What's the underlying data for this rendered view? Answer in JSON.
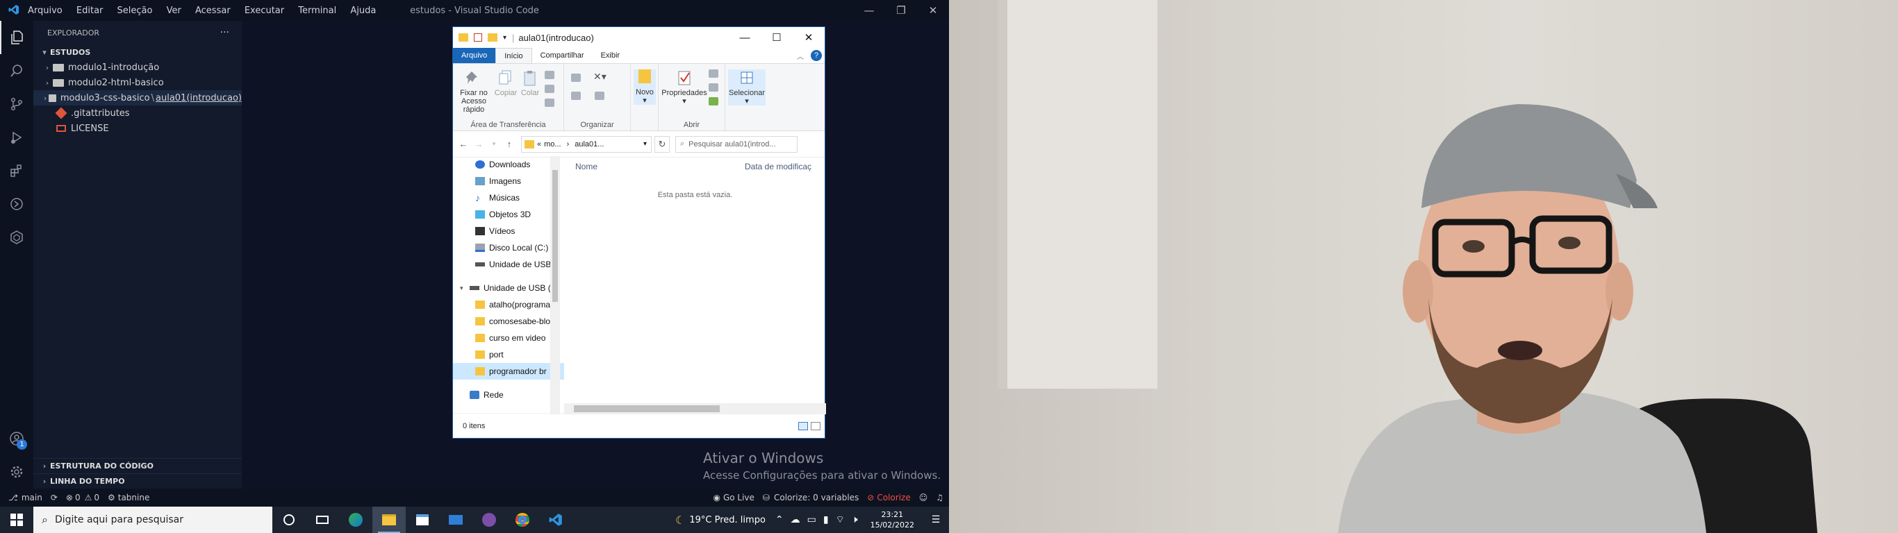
{
  "vscode": {
    "menu": [
      "Arquivo",
      "Editar",
      "Seleção",
      "Ver",
      "Acessar",
      "Executar",
      "Terminal",
      "Ajuda"
    ],
    "window_title": "estudos - Visual Studio Code",
    "sidebar": {
      "title": "EXPLORADOR",
      "more": "···",
      "workspace": "ESTUDOS",
      "items": [
        {
          "label": "modulo1-introdução"
        },
        {
          "label": "modulo2-html-basico"
        },
        {
          "label": "modulo3-css-basico",
          "suffix": "aula01(introducao)"
        },
        {
          "label": ".gitattributes"
        },
        {
          "label": "LICENSE"
        }
      ],
      "bottom_sections": [
        "ESTRUTURA DO CÓDIGO",
        "LINHA DO TEMPO"
      ]
    },
    "account_badge": "1",
    "statusbar": {
      "branch": "main",
      "problems_errors": "0",
      "problems_warnings": "0",
      "tabnine": "tabnine",
      "golive": "Go Live",
      "colorize_vars": "Colorize: 0 variables",
      "colorize": "Colorize",
      "accent": "#f05040"
    }
  },
  "file_explorer": {
    "title": "aula01(introducao)",
    "tabs": [
      "Arquivo",
      "Início",
      "Compartilhar",
      "Exibir"
    ],
    "active_tab": "Início",
    "ribbon": {
      "clipboard": {
        "pin": "Fixar no Acesso rápido",
        "copy": "Copiar",
        "paste": "Colar",
        "group": "Área de Transferência"
      },
      "organize": {
        "group": "Organizar"
      },
      "new": {
        "label": "Novo"
      },
      "open": {
        "properties": "Propriedades",
        "group": "Abrir"
      },
      "select": {
        "label": "Selecionar"
      }
    },
    "address": {
      "part1": "mo...",
      "part2": "aula01..."
    },
    "search_placeholder": "Pesquisar aula01(introd...",
    "nav_items": [
      {
        "label": "Downloads",
        "icon": "download-icon"
      },
      {
        "label": "Imagens",
        "icon": "images-icon"
      },
      {
        "label": "Músicas",
        "icon": "music-icon"
      },
      {
        "label": "Objetos 3D",
        "icon": "cube-icon"
      },
      {
        "label": "Vídeos",
        "icon": "video-icon"
      },
      {
        "label": "Disco Local (C:)",
        "icon": "drive-icon"
      },
      {
        "label": "Unidade de USB",
        "icon": "usb-icon"
      }
    ],
    "usb_label": "Unidade de USB (E",
    "usb_items": [
      "atalho(programa",
      "comosesabe-blo",
      "curso em video",
      "port",
      "programador br"
    ],
    "network": "Rede",
    "columns": {
      "name": "Nome",
      "date": "Data de modificaç"
    },
    "empty_message": "Esta pasta está vazia.",
    "status": "0 itens"
  },
  "watermark": {
    "line1": "Ativar o Windows",
    "line2": "Acesse Configurações para ativar o Windows."
  },
  "taskbar": {
    "search_placeholder": "Digite aqui para pesquisar",
    "weather": "19°C  Pred. limpo",
    "time": "23:21",
    "date": "15/02/2022"
  }
}
